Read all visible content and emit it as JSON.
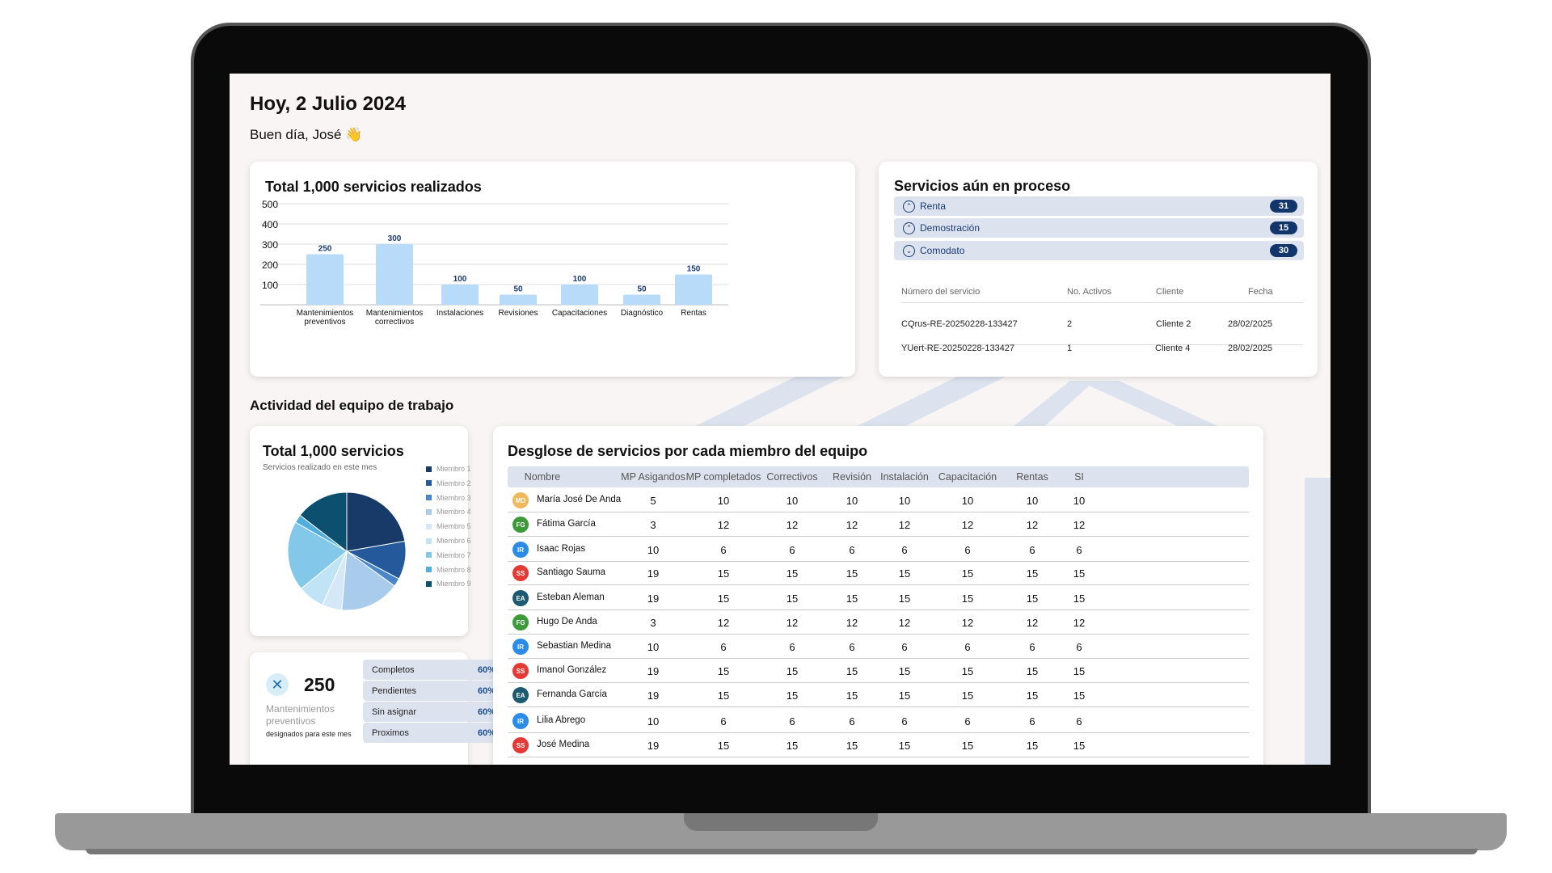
{
  "header": {
    "title": "Hoy, 2 Julio 2024",
    "greeting": "Buen día, José 👋"
  },
  "services_card": {
    "title": "Total 1,000 servicios realizados"
  },
  "chart_data": [
    {
      "type": "bar",
      "title": "Total 1,000 servicios realizados",
      "categories": [
        [
          "Mantenimientos",
          "preventivos"
        ],
        [
          "Mantenimientos",
          "correctivos"
        ],
        [
          "Instalaciones"
        ],
        [
          "Revisiones"
        ],
        [
          "Capacitaciones"
        ],
        [
          "Diagnóstico"
        ],
        [
          "Rentas"
        ]
      ],
      "values": [
        250,
        300,
        100,
        50,
        100,
        50,
        150
      ],
      "yticks": [
        100,
        200,
        300,
        400,
        500
      ],
      "ylim": [
        0,
        500
      ],
      "grid": true,
      "data_labels": true,
      "colors": {
        "bar": "#b8dbfa",
        "label": "#1a3a73"
      }
    },
    {
      "type": "pie",
      "title": "Total 1,000 servicios",
      "subtitle": "Servicios realizado en este mes",
      "labels": [
        "Miembro 1",
        "Miembro 2",
        "Miembro 3",
        "Miembro 4",
        "Miembro 5",
        "Miembro 6",
        "Miembro 7",
        "Miembro 8",
        "Miembro 9"
      ],
      "values": [
        24.5,
        11.5,
        2.5,
        18,
        6,
        8,
        21,
        2.5,
        16
      ],
      "colors": [
        "#183a68",
        "#24599b",
        "#4a86cc",
        "#a9cbec",
        "#d5e8f8",
        "#c0e4f6",
        "#83c8e8",
        "#52aedc",
        "#0c4f6e"
      ],
      "legend": "right"
    }
  ],
  "process": {
    "title": "Servicios aún en proceso",
    "rows": [
      {
        "label": "Renta",
        "count": "31",
        "chevron": "⌃"
      },
      {
        "label": "Demostración",
        "count": "15",
        "chevron": "⌃"
      },
      {
        "label": "Comodato",
        "count": "30",
        "chevron": "⌄"
      }
    ],
    "table": {
      "headers": [
        "Número del servicio",
        "No. Activos",
        "Cliente",
        "Fecha"
      ],
      "rows": [
        [
          "CQrus-RE-20250228-133427",
          "2",
          "Cliente 2",
          "28/02/2025"
        ],
        [
          "YUert-RE-20250228-133427",
          "1",
          "Cliente 4",
          "28/02/2025"
        ]
      ]
    }
  },
  "team": {
    "section_title": "Actividad del equipo de trabajo",
    "pie_title": "Total 1,000 servicios",
    "pie_subtitle": "Servicios realizado en este mes"
  },
  "stats": {
    "icon": "tools-icon",
    "number": "250",
    "label": "Mantenimientos preventivos",
    "desc": "designados para este mes",
    "pills": [
      {
        "label": "Completos",
        "value": "60%"
      },
      {
        "label": "Pendientes",
        "value": "60%"
      },
      {
        "label": "Sin asignar",
        "value": "60%"
      },
      {
        "label": "Proximos",
        "value": "60%"
      }
    ]
  },
  "breakdown": {
    "title": "Desglose de servicios por cada miembro del equipo",
    "headers": [
      "Nombre",
      "MP Asigandos",
      "MP completados",
      "Correctivos",
      "Revisión",
      "Instalación",
      "Capacitación",
      "Rentas",
      "SI"
    ],
    "rows": [
      {
        "initials": "MD",
        "color": "#f0b85a",
        "name": "María José De Anda",
        "values": [
          "5",
          "10",
          "10",
          "10",
          "10",
          "10",
          "10",
          "10"
        ]
      },
      {
        "initials": "FG",
        "color": "#3d9a3a",
        "name": "Fátima García",
        "values": [
          "3",
          "12",
          "12",
          "12",
          "12",
          "12",
          "12",
          "12"
        ]
      },
      {
        "initials": "IR",
        "color": "#2b8be8",
        "name": "Isaac Rojas",
        "values": [
          "10",
          "6",
          "6",
          "6",
          "6",
          "6",
          "6",
          "6"
        ]
      },
      {
        "initials": "SS",
        "color": "#e53935",
        "name": "Santiago Sauma",
        "values": [
          "19",
          "15",
          "15",
          "15",
          "15",
          "15",
          "15",
          "15"
        ]
      },
      {
        "initials": "EA",
        "color": "#1c5a72",
        "name": "Esteban Aleman",
        "values": [
          "19",
          "15",
          "15",
          "15",
          "15",
          "15",
          "15",
          "15"
        ]
      },
      {
        "initials": "FG",
        "color": "#3d9a3a",
        "name": "Hugo De Anda",
        "values": [
          "3",
          "12",
          "12",
          "12",
          "12",
          "12",
          "12",
          "12"
        ]
      },
      {
        "initials": "IR",
        "color": "#2b8be8",
        "name": "Sebastian Medina",
        "values": [
          "10",
          "6",
          "6",
          "6",
          "6",
          "6",
          "6",
          "6"
        ]
      },
      {
        "initials": "SS",
        "color": "#e53935",
        "name": "Imanol González",
        "values": [
          "19",
          "15",
          "15",
          "15",
          "15",
          "15",
          "15",
          "15"
        ]
      },
      {
        "initials": "EA",
        "color": "#1c5a72",
        "name": "Fernanda García",
        "values": [
          "19",
          "15",
          "15",
          "15",
          "15",
          "15",
          "15",
          "15"
        ]
      },
      {
        "initials": "IR",
        "color": "#2b8be8",
        "name": "Lilia Abrego",
        "values": [
          "10",
          "6",
          "6",
          "6",
          "6",
          "6",
          "6",
          "6"
        ]
      },
      {
        "initials": "SS",
        "color": "#e53935",
        "name": "José Medina",
        "values": [
          "19",
          "15",
          "15",
          "15",
          "15",
          "15",
          "15",
          "15"
        ]
      }
    ]
  }
}
